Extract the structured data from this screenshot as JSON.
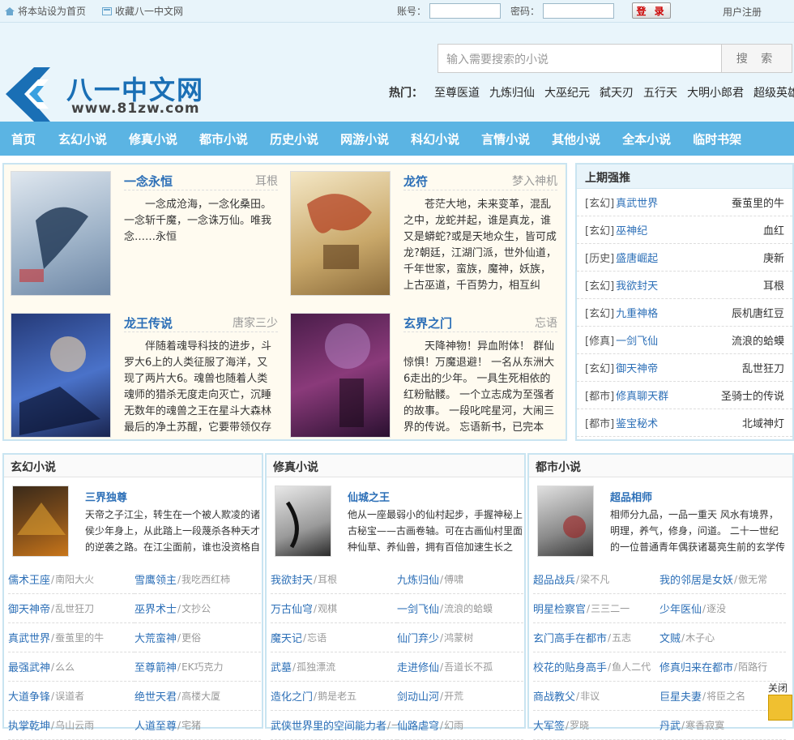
{
  "topbar": {
    "set_home": "将本站设为首页",
    "bookmark": "收藏八一中文网",
    "account_label": "账号：",
    "password_label": "密码：",
    "login_button": "登 录",
    "register": "用户注册"
  },
  "header": {
    "logo_text": "八一中文网",
    "logo_url": "www.81zw.com",
    "search_placeholder": "输入需要搜索的小说",
    "search_button": "搜 索",
    "hot_label": "热门：",
    "hot_items": [
      "至尊医道",
      "九炼归仙",
      "大巫纪元",
      "弑天刃",
      "五行天",
      "大明小郎君",
      "超级英雄"
    ]
  },
  "nav": [
    "首页",
    "玄幻小说",
    "修真小说",
    "都市小说",
    "历史小说",
    "网游小说",
    "科幻小说",
    "言情小说",
    "其他小说",
    "全本小说",
    "临时书架"
  ],
  "featured": [
    {
      "title": "一念永恒",
      "author": "耳根",
      "desc": "一念成沧海，一念化桑田。一念斩千魔，一念诛万仙。唯我念……永恒"
    },
    {
      "title": "龙符",
      "author": "梦入神机",
      "desc": "苍茫大地，未来变革，混乱之中，龙蛇并起，谁是真龙，谁又是蟒蛇?或是天地众生，皆可成龙?朝廷，江湖门派，世外仙道，千年世家，蛮族，魔神，妖族，上古巫道，千百势力，相互纠缠，因缘际"
    },
    {
      "title": "龙王传说",
      "author": "唐家三少",
      "desc": "伴随着魂导科技的进步，斗罗大6上的人类征服了海洋，又现了两片大6。魂兽也随着人类魂师的猎杀无度走向灭亡，沉睡无数年的魂兽之王在星斗大森林最后的净土苏醒，它要带领仅存的族人，向人类"
    },
    {
      "title": "玄界之门",
      "author": "忘语",
      "desc": "天降神物！异血附体！ 群仙惊惧！万魔退避！ 一名从东洲大6走出的少年。 一具生死相依的红粉骷髅。 一个立志成为至强者的故事。 一段叱咤星河，大闹三界的传说。 忘语新书，已完本《凡人修仙"
    }
  ],
  "rank": {
    "title": "上期强推",
    "items": [
      {
        "cat": "[玄幻]",
        "name": "真武世界",
        "author": "蚕茧里的牛"
      },
      {
        "cat": "[玄幻]",
        "name": "巫神纪",
        "author": "血红"
      },
      {
        "cat": "[历史]",
        "name": "盛唐崛起",
        "author": "庚新"
      },
      {
        "cat": "[玄幻]",
        "name": "我欲封天",
        "author": "耳根"
      },
      {
        "cat": "[玄幻]",
        "name": "九重神格",
        "author": "辰机唐红豆"
      },
      {
        "cat": "[修真]",
        "name": "一剑飞仙",
        "author": "流浪的蛤蟆"
      },
      {
        "cat": "[玄幻]",
        "name": "御天神帝",
        "author": "乱世狂刀"
      },
      {
        "cat": "[都市]",
        "name": "修真聊天群",
        "author": "圣骑士的传说"
      },
      {
        "cat": "[都市]",
        "name": "鉴宝秘术",
        "author": "北域神灯"
      }
    ]
  },
  "categories": [
    {
      "title": "玄幻小说",
      "book_title": "三界独尊",
      "book_desc": "天帝之子江尘，转生在一个被人欺凌的诸侯少年身上，从此踏上一段蔑杀各种天才的逆袭之路。在江尘面前，谁也没资格自",
      "list": [
        {
          "name": "儒术王座",
          "author": "南阳大火"
        },
        {
          "name": "雪鹰领主",
          "author": "我吃西红柿"
        },
        {
          "name": "御天神帝",
          "author": "乱世狂刀"
        },
        {
          "name": "巫界术士",
          "author": "文抄公"
        },
        {
          "name": "真武世界",
          "author": "蚕茧里的牛"
        },
        {
          "name": "大荒蛮神",
          "author": "更俗"
        },
        {
          "name": "最强武神",
          "author": "么么"
        },
        {
          "name": "至尊箭神",
          "author": "EK巧克力"
        },
        {
          "name": "大道争锋",
          "author": "误道者"
        },
        {
          "name": "绝世天君",
          "author": "高楼大厦"
        },
        {
          "name": "执掌乾坤",
          "author": "乌山云雨"
        },
        {
          "name": "人道至尊",
          "author": "宅猪"
        }
      ]
    },
    {
      "title": "修真小说",
      "book_title": "仙城之王",
      "book_desc": "他从一座最弱小的仙村起步，手握神秘上古秘宝——古画卷轴。可在古画仙村里面种仙草、养仙兽，拥有百倍加速生长之",
      "list": [
        {
          "name": "我欲封天",
          "author": "耳根"
        },
        {
          "name": "九炼归仙",
          "author": "傅啸"
        },
        {
          "name": "万古仙穹",
          "author": "观棋"
        },
        {
          "name": "一剑飞仙",
          "author": "流浪的蛤蟆"
        },
        {
          "name": "魔天记",
          "author": "忘语"
        },
        {
          "name": "仙门弃少",
          "author": "鸿蒙树"
        },
        {
          "name": "武墓",
          "author": "孤独漂流"
        },
        {
          "name": "走进修仙",
          "author": "吾道长不孤"
        },
        {
          "name": "造化之门",
          "author": "鹅是老五"
        },
        {
          "name": "剑动山河",
          "author": "开荒"
        },
        {
          "name": "武侠世界里的空间能力者",
          "author": "一"
        },
        {
          "name": "仙路虐穹",
          "author": "幻雨"
        }
      ]
    },
    {
      "title": "都市小说",
      "book_title": "超品相师",
      "book_desc": "相师分九品，一品一重天 风水有境界，明理，养气，修身，问道。 二十一世纪的一位普通青年偶获诸葛亮生前的玄学传",
      "list": [
        {
          "name": "超品战兵",
          "author": "梁不凡"
        },
        {
          "name": "我的邻居是女妖",
          "author": "傲无常"
        },
        {
          "name": "明星检察官",
          "author": "三三二一"
        },
        {
          "name": "少年医仙",
          "author": "逐没"
        },
        {
          "name": "玄门高手在都市",
          "author": "五志"
        },
        {
          "name": "文贼",
          "author": "木子心"
        },
        {
          "name": "校花的贴身高手",
          "author": "鱼人二代"
        },
        {
          "name": "修真归来在都市",
          "author": "陌路行"
        },
        {
          "name": "商战教父",
          "author": "非议"
        },
        {
          "name": "巨星夫妻",
          "author": "将臣之名"
        },
        {
          "name": "大军签",
          "author": "罗晓"
        },
        {
          "name": "丹武",
          "author": "寒香寂寞"
        }
      ]
    }
  ],
  "close_label": "关闭"
}
